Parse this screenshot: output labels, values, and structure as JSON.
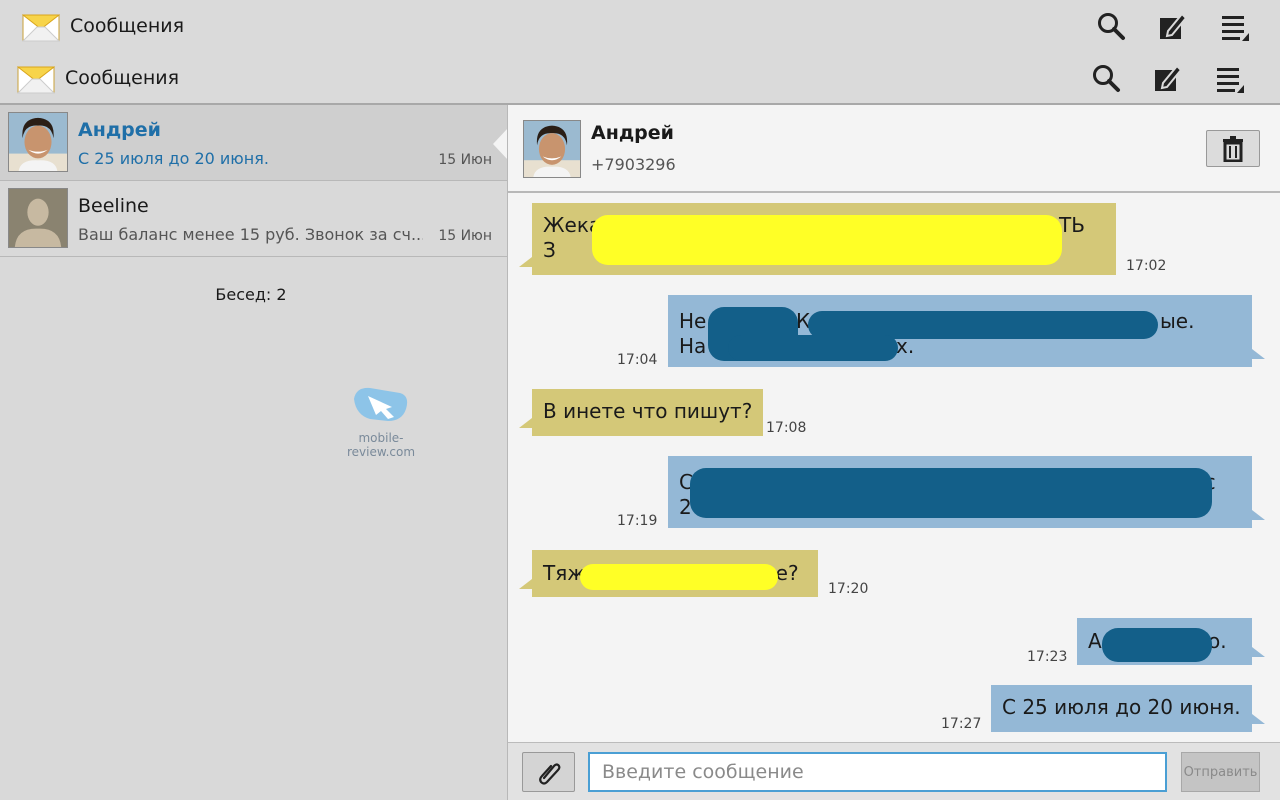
{
  "colors": {
    "accent": "#1f6fa8",
    "incoming": "#d4c878",
    "outgoing": "#94b8d6"
  },
  "appbar": {
    "title": "Сообщения",
    "icons": [
      "search-icon",
      "compose-icon",
      "menu-icon"
    ]
  },
  "appbar2": {
    "title": "Сообщения"
  },
  "conversations": [
    {
      "name": "Андрей",
      "snippet": "С 25 июля до 20 июня.",
      "date": "15 Июн"
    },
    {
      "name": "Beeline",
      "snippet": "Ваш баланс менее 15 руб. Звонок за сч...",
      "date": "15 Июн"
    }
  ],
  "conversation_count": "Бесед: 2",
  "watermark": "mobile-review.com",
  "chat": {
    "name": "Андрей",
    "phone": "+7903296",
    "messages": [
      {
        "dir": "in",
        "l1": "Жека:ПР",
        "l1b": "ТЬ",
        "l2": "З",
        "time": "17:02"
      },
      {
        "dir": "out",
        "l1": "Не",
        "l1m": "К",
        "l1b": "ые.",
        "l2": "На",
        "l2b": "х.",
        "time": "17:04"
      },
      {
        "dir": "in",
        "text": "В инете что пишут?",
        "time": "17:08"
      },
      {
        "dir": "out",
        "l1": "Ср",
        "l1b": "е с",
        "l2": "20",
        "time": "17:19"
      },
      {
        "dir": "in",
        "l1": "Тяжело",
        "l1b": "те?",
        "time": "17:20"
      },
      {
        "dir": "out",
        "l1": "А",
        "l1b": "о.",
        "time": "17:23"
      },
      {
        "dir": "out",
        "text": "С 25 июля до 20 июня.",
        "time": "17:27"
      }
    ]
  },
  "composer": {
    "placeholder": "Введите сообщение",
    "send_label": "Отправить"
  }
}
